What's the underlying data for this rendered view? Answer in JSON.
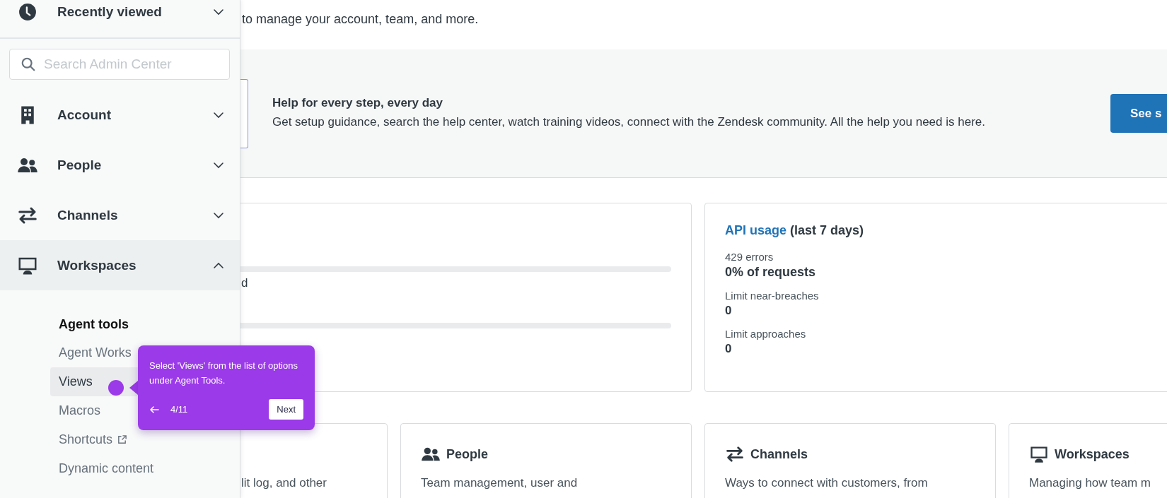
{
  "sidebar": {
    "recent": {
      "label": "Recently viewed",
      "expanded": false
    },
    "search": {
      "placeholder": "Search Admin Center"
    },
    "sections": [
      {
        "kind": "building",
        "label": "Account",
        "expanded": false
      },
      {
        "kind": "people",
        "label": "People",
        "expanded": false
      },
      {
        "kind": "arrows",
        "label": "Channels",
        "expanded": false
      },
      {
        "kind": "monitor",
        "label": "Workspaces",
        "expanded": true,
        "group": "Agent tools",
        "items": [
          {
            "label": "Agent Works",
            "selected": false,
            "external": false
          },
          {
            "label": "Views",
            "selected": true,
            "external": false
          },
          {
            "label": "Macros",
            "selected": false,
            "external": false
          },
          {
            "label": "Shortcuts",
            "selected": false,
            "external": true
          },
          {
            "label": "Dynamic content",
            "selected": false,
            "external": false
          }
        ]
      }
    ]
  },
  "intro": "to manage your account, team, and more.",
  "banner": {
    "title": "Help for every step, every day",
    "text": "Get setup guidance, search the help center, watch training videos, connect with the Zendesk community. All the help you need is here.",
    "button": "See s"
  },
  "usage_card": {
    "fragment": "d"
  },
  "api_card": {
    "link": "API usage",
    "title": "(last 7 days)",
    "stats": [
      {
        "label": "429 errors",
        "value": "0% of requests"
      },
      {
        "label": "Limit near-breaches",
        "value": "0"
      },
      {
        "label": "Limit approaches",
        "value": "0"
      }
    ]
  },
  "categories": [
    {
      "kind": "none",
      "text": "lit log, and other"
    },
    {
      "kind": "people",
      "title": "People",
      "text": "Team management, user and"
    },
    {
      "kind": "arrows",
      "title": "Channels",
      "text": "Ways to connect with customers, from"
    },
    {
      "kind": "monitor",
      "title": "Workspaces",
      "text": "Managing how team m"
    }
  ],
  "tooltip": {
    "text": "Select 'Views' from the list of options under Agent Tools.",
    "step": "4/11",
    "button": "Next"
  }
}
